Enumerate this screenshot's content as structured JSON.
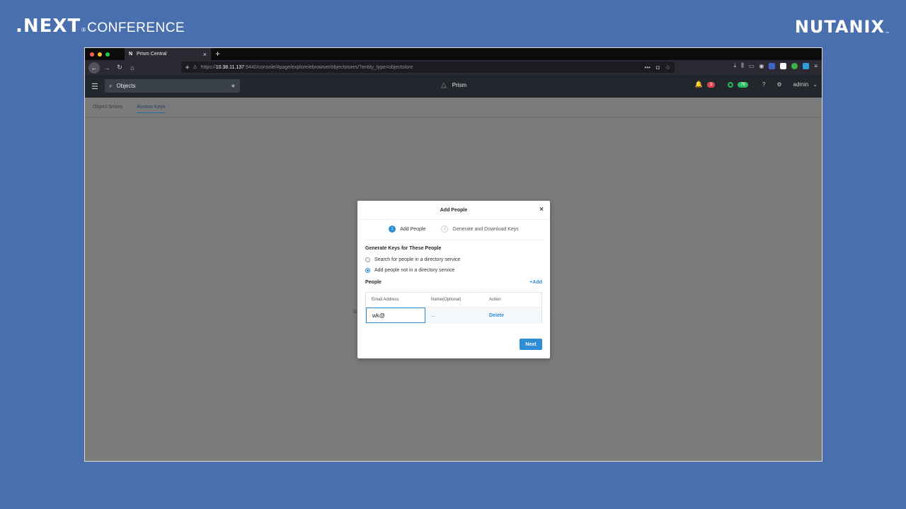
{
  "slide": {
    "left_brand": {
      "next": ".NEXT",
      "reg": "®",
      "conference": "CONFERENCE"
    },
    "right_brand": {
      "name": "NUTANIX",
      "tm": "™"
    }
  },
  "browser": {
    "tab_title": "Prism Central",
    "tab_favicon": "N",
    "url_scheme": "https://",
    "url_host": "10.38.11.137",
    "url_rest": ":9440/console/#page/explore/ebrowser/objectstores/?entity_type=objectstore",
    "traffic_colors": [
      "#fe5f57",
      "#febc2e",
      "#28c840"
    ]
  },
  "prism": {
    "search_value": "Objects",
    "brand": "Prism",
    "alert_count": "3",
    "health_count": "76",
    "user": "admin",
    "subtabs": [
      {
        "label": "Object Stores",
        "active": false
      },
      {
        "label": "Access Keys",
        "active": true
      }
    ],
    "bg_fragment_left": "G",
    "bg_fragment_right": "."
  },
  "modal": {
    "title": "Add People",
    "steps": [
      {
        "num": "1",
        "label": "Add People",
        "active": true
      },
      {
        "num": "2",
        "label": "Generate and Download Keys",
        "active": false
      }
    ],
    "section_title": "Generate Keys for These People",
    "options": [
      {
        "label": "Search for people in a directory service",
        "checked": false
      },
      {
        "label": "Add people not in a directory service",
        "checked": true
      }
    ],
    "people_label": "People",
    "add_label": "+Add",
    "table": {
      "headers": [
        "Email Address",
        "Name(Optional)",
        "Action"
      ],
      "row": {
        "email": "wk@",
        "name": "...",
        "action": "Delete"
      }
    },
    "next_label": "Next"
  },
  "colors": {
    "slide_bg": "#4a6fae",
    "accent": "#2d8dd6",
    "prism_header": "#22272e",
    "alert_red": "#e0434b",
    "health_green": "#26bb62"
  }
}
